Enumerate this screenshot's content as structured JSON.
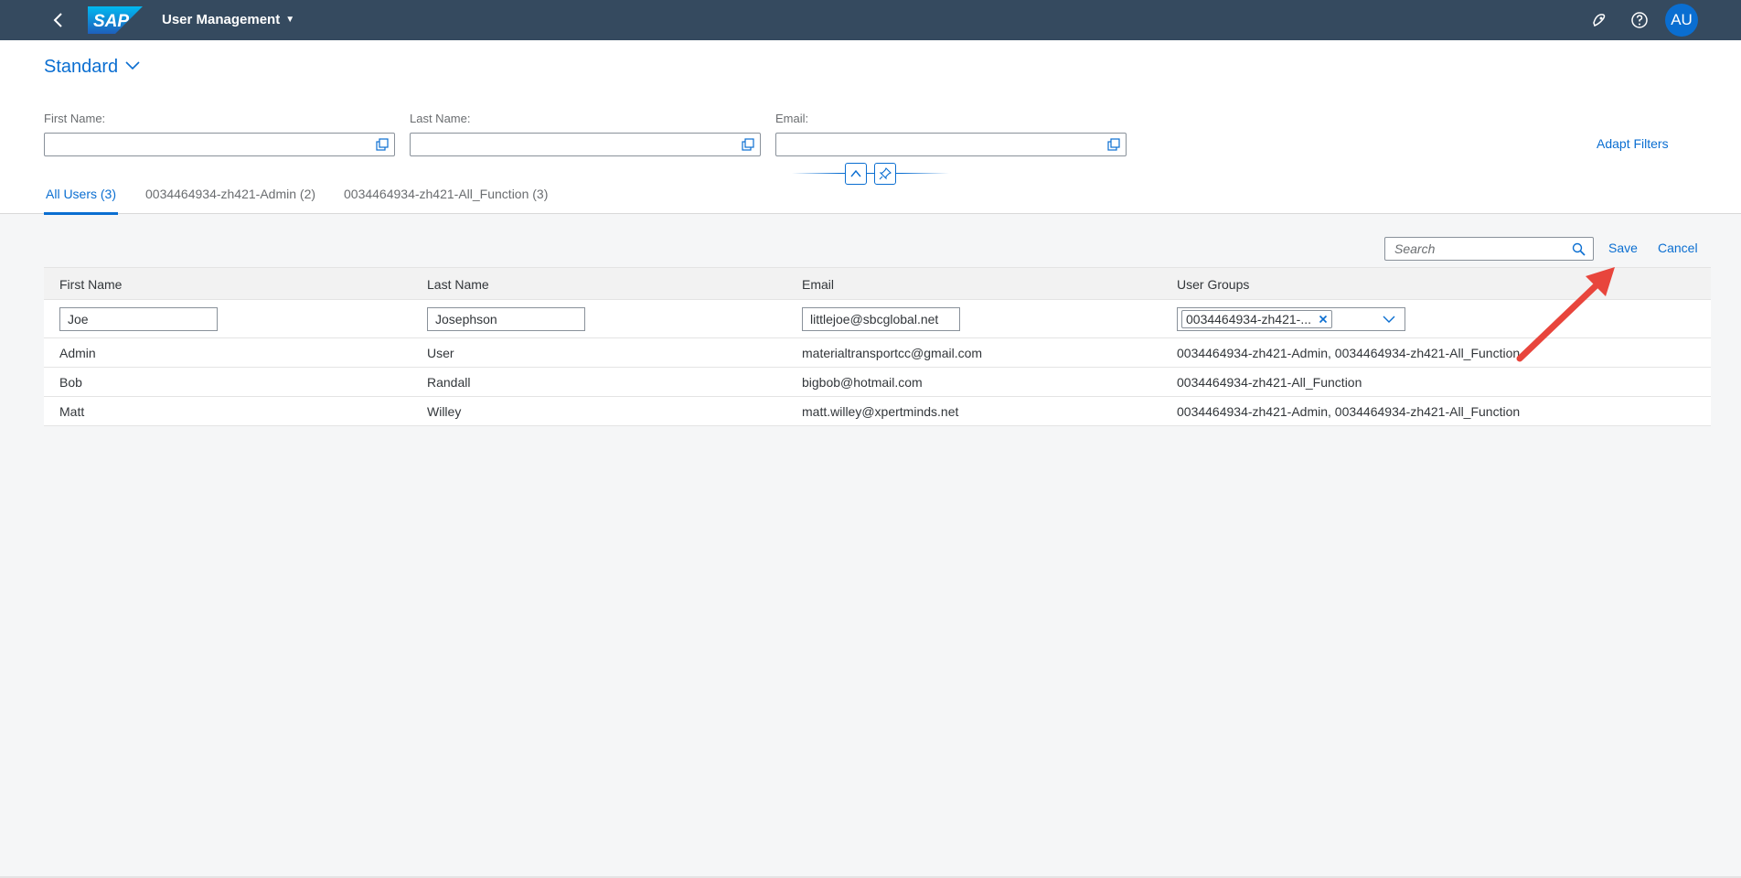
{
  "shell": {
    "app_title": "User Management",
    "avatar_initials": "AU",
    "logo_text": "SAP"
  },
  "variant": {
    "label": "Standard"
  },
  "filters": {
    "first_name_label": "First Name:",
    "last_name_label": "Last Name:",
    "email_label": "Email:",
    "adapt_label": "Adapt Filters"
  },
  "tabs": [
    {
      "label": "All Users (3)"
    },
    {
      "label": "0034464934-zh421-Admin (2)"
    },
    {
      "label": "0034464934-zh421-All_Function (3)"
    }
  ],
  "toolbar": {
    "search_placeholder": "Search",
    "save_label": "Save",
    "cancel_label": "Cancel"
  },
  "table": {
    "columns": [
      "First Name",
      "Last Name",
      "Email",
      "User Groups"
    ],
    "edit_row": {
      "first_name": "Joe",
      "last_name": "Josephson",
      "email": "littlejoe@sbcglobal.net",
      "group_token": "0034464934-zh421-..."
    },
    "rows": [
      {
        "first_name": "Admin",
        "last_name": "User",
        "email": "materialtransportcc@gmail.com",
        "groups": "0034464934-zh421-Admin, 0034464934-zh421-All_Function"
      },
      {
        "first_name": "Bob",
        "last_name": "Randall",
        "email": "bigbob@hotmail.com",
        "groups": "0034464934-zh421-All_Function"
      },
      {
        "first_name": "Matt",
        "last_name": "Willey",
        "email": "matt.willey@xpertminds.net",
        "groups": "0034464934-zh421-Admin, 0034464934-zh421-All_Function"
      }
    ]
  },
  "colors": {
    "shell_bg": "#354a5f",
    "accent": "#0a6ed1",
    "annotation_arrow": "#e8453c"
  }
}
